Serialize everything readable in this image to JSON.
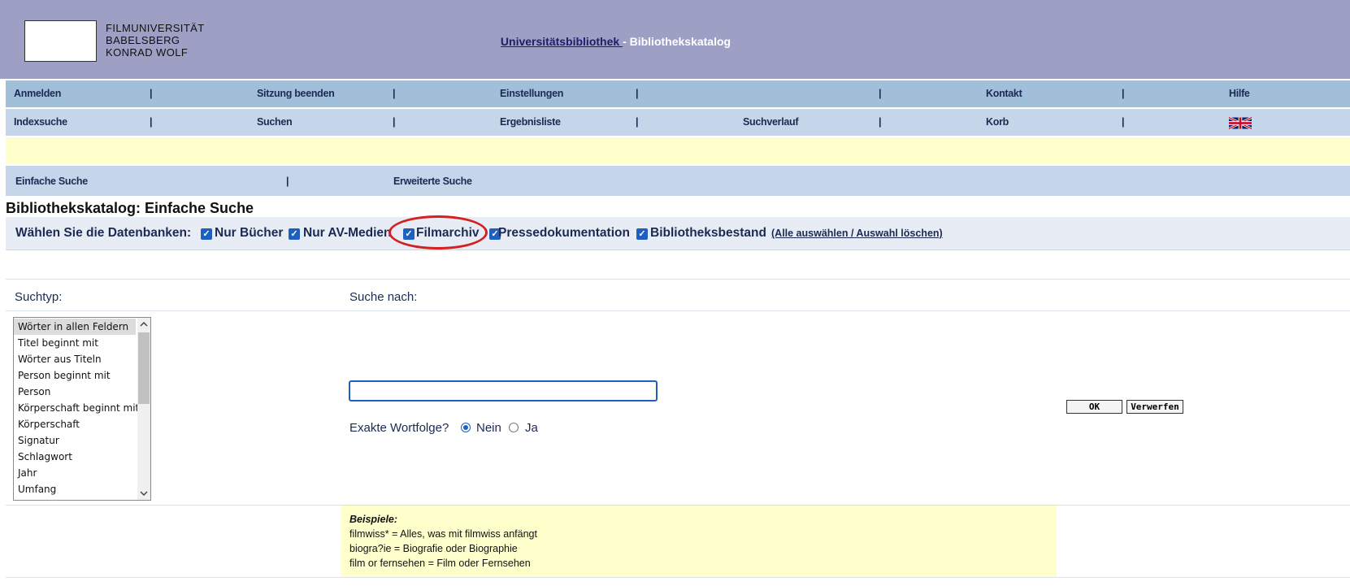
{
  "header": {
    "logo_lines": [
      "FILMUNIVERSITÄT",
      "BABELSBERG",
      "KONRAD WOLF"
    ],
    "library_link": "Universitätsbibliothek ",
    "catalog_label": "- Bibliothekskatalog"
  },
  "nav_row1": [
    "Anmelden",
    "|",
    "Sitzung beenden",
    "|",
    "Einstellungen",
    "|",
    "|",
    "Kontakt",
    "|",
    "Hilfe"
  ],
  "nav_row2": [
    "Indexsuche",
    "|",
    "Suchen",
    "|",
    "Ergebnisliste",
    "|",
    "Suchverlauf",
    "|",
    "Korb",
    "|"
  ],
  "search_tabs": {
    "simple": "Einfache Suche",
    "separator": "|",
    "advanced": "Erweiterte Suche"
  },
  "page_title": "Bibliothekskatalog: Einfache Suche",
  "databases": {
    "label": "Wählen Sie die Datenbanken:",
    "items": [
      {
        "label": "Nur Bücher",
        "checked": true
      },
      {
        "label": "Nur AV-Medien",
        "checked": true
      },
      {
        "label": "Filmarchiv",
        "checked": true,
        "highlighted": true
      },
      {
        "label": "Pressedokumentation",
        "checked": true
      },
      {
        "label": "Bibliotheksbestand",
        "checked": true
      }
    ],
    "select_all_link": "(Alle auswählen / Auswahl löschen)"
  },
  "search_type": {
    "label": "Suchtyp:",
    "options": [
      "Wörter in allen Feldern",
      "Titel beginnt mit",
      "Wörter aus Titeln",
      "Person beginnt mit",
      "Person",
      "Körperschaft beginnt mit",
      "Körperschaft",
      "Signatur",
      "Schlagwort",
      "Jahr",
      "Umfang"
    ],
    "selected": "Wörter in allen Feldern"
  },
  "search_for": {
    "label": "Suche nach:",
    "value": "",
    "exact_label": "Exakte Wortfolge?",
    "exact_no": "Nein",
    "exact_yes": "Ja",
    "exact_selected": "Nein"
  },
  "buttons": {
    "ok": "OK",
    "reset": "Verwerfen"
  },
  "examples": {
    "title": "Beispiele:",
    "lines": [
      "filmwiss* = Alles, was mit filmwiss anfängt",
      "biogra?ie = Biografie oder Biographie",
      "film or fernsehen = Film oder Fernsehen"
    ]
  },
  "colors": {
    "header_bg": "#9d9fc4",
    "nav1_bg": "#a1bfd8",
    "nav2_bg": "#c6d6ea",
    "highlight_bg": "#ffffcc",
    "accent": "#1f5fc0",
    "annotation_circle": "#d42020"
  }
}
